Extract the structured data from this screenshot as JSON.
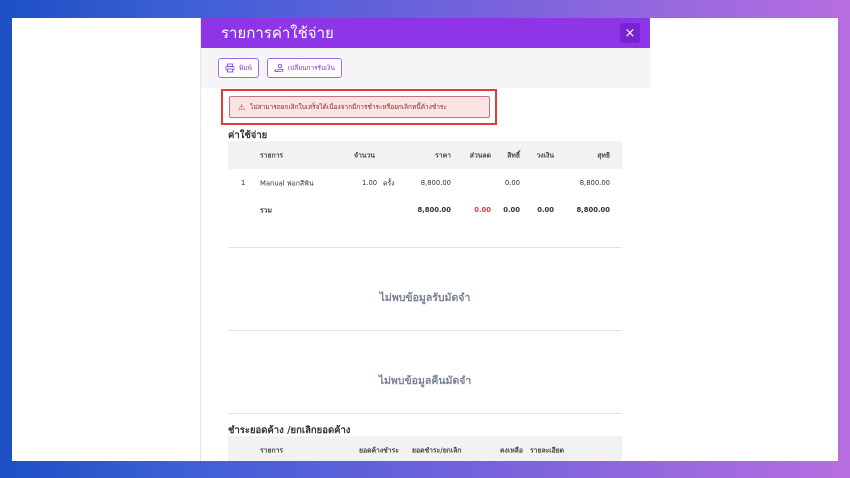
{
  "modal": {
    "title": "รายการค่าใช้จ่าย",
    "close_label": "×"
  },
  "toolbar": {
    "print_label": "พิมพ์",
    "change_payment_label": "เปลี่ยนการรับเงิน"
  },
  "alert": {
    "message": "ไม่สามารถยกเลิกใบเสร็จได้เนื่องจากมีการชำระหรือยกเลิกหนี้ค้างชำระ"
  },
  "expenses": {
    "title": "ค่าใช้จ่าย",
    "headers": [
      "รายการ",
      "จำนวน",
      "ราคา",
      "ส่วนลด",
      "สิทธิ์",
      "วงเงิน",
      "สุทธิ"
    ],
    "rows": [
      {
        "no": "1",
        "item": "Manual ฟอกสีฟัน",
        "qty": "1.00",
        "unit": "ครั้ง",
        "price": "8,800.00",
        "discount": "",
        "right": "0.00",
        "limit": "",
        "net": "8,800.00"
      }
    ],
    "total": {
      "label": "รวม",
      "price": "8,800.00",
      "discount": "0.00",
      "right": "0.00",
      "limit": "0.00",
      "net": "8,800.00"
    }
  },
  "deposit_receive": {
    "empty_message": "ไม่พบข้อมูลรับมัดจำ"
  },
  "deposit_return": {
    "empty_message": "ไม่พบข้อมูลคืนมัดจำ"
  },
  "outstanding": {
    "title": "ชำระยอดค้าง /ยกเลิกยอดค้าง",
    "headers": [
      "รายการ",
      "ยอดค้างชำระ",
      "ยอดชำระ/ยกเลิก",
      "คงเหลือ",
      "รายละเอียด"
    ]
  },
  "colors": {
    "accent": "#8e35e8",
    "alert_border": "#e23b3b",
    "discount_red": "#e23b3b"
  }
}
